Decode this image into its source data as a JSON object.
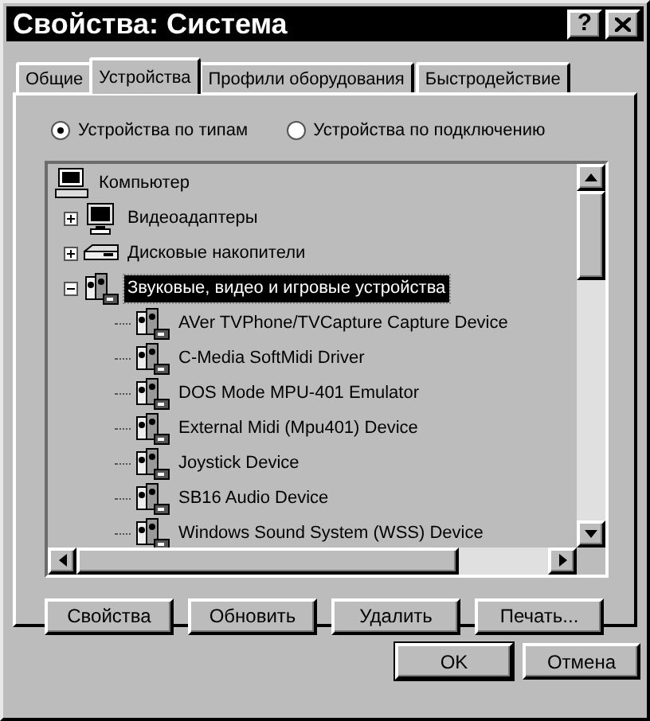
{
  "window": {
    "title": "Свойства: Система",
    "title_buttons": [
      {
        "kind": "help",
        "label": "?"
      },
      {
        "kind": "close"
      }
    ]
  },
  "tabs": [
    {
      "label": "Общие",
      "selected": false
    },
    {
      "label": "Устройства",
      "selected": true
    },
    {
      "label": "Профили оборудования",
      "selected": false
    },
    {
      "label": "Быстродействие",
      "selected": false
    }
  ],
  "view_options": [
    {
      "label": "Устройства по типам",
      "selected": true
    },
    {
      "label": "Устройства по подключению",
      "selected": false
    }
  ],
  "tree": [
    {
      "label": "Компьютер",
      "kind": "computer",
      "selected": false,
      "children": [
        {
          "label": "Видеоадаптеры",
          "kind": "monitor",
          "expanded": false,
          "selected": false
        },
        {
          "label": "Дисковые накопители",
          "kind": "disk",
          "expanded": false,
          "selected": false
        },
        {
          "label": "Звуковые, видео и игровые устройства",
          "kind": "multimedia",
          "expanded": true,
          "selected": true,
          "children": [
            {
              "label": "AVer TVPhone/TVCapture Capture Device",
              "kind": "multimedia",
              "selected": false
            },
            {
              "label": "C-Media SoftMidi Driver",
              "kind": "multimedia",
              "selected": false
            },
            {
              "label": "DOS Mode MPU-401 Emulator",
              "kind": "multimedia",
              "selected": false
            },
            {
              "label": "External Midi (Mpu401) Device",
              "kind": "multimedia",
              "selected": false
            },
            {
              "label": "Joystick Device",
              "kind": "multimedia",
              "selected": false
            },
            {
              "label": "SB16 Audio Device",
              "kind": "multimedia",
              "selected": false
            },
            {
              "label": "Windows Sound System (WSS) Device",
              "kind": "multimedia",
              "selected": false
            }
          ]
        }
      ]
    }
  ],
  "device_buttons": [
    "Свойства",
    "Обновить",
    "Удалить",
    "Печать..."
  ],
  "dialog_buttons": [
    {
      "label": "OK",
      "default": true
    },
    {
      "label": "Отмена",
      "default": false
    }
  ]
}
